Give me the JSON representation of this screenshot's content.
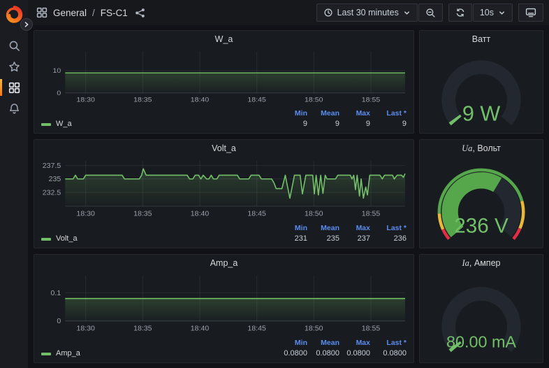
{
  "topbar": {
    "folder": "General",
    "separator": "/",
    "dashboard": "FS-C1",
    "time_range_label": "Last 30 minutes",
    "refresh_interval": "10s"
  },
  "legend_columns": [
    "Min",
    "Mean",
    "Max",
    "Last *"
  ],
  "charts": [
    {
      "type": "area",
      "title": "W_a",
      "series_name": "W_a",
      "unit": "W",
      "x_min": 28.2,
      "x_max": 58.0,
      "y_min": 0,
      "y_max": 18.7,
      "x_ticks": [
        {
          "value": 30,
          "label": "18:30"
        },
        {
          "value": 35,
          "label": "18:35"
        },
        {
          "value": 40,
          "label": "18:40"
        },
        {
          "value": 45,
          "label": "18:45"
        },
        {
          "value": 50,
          "label": "18:50"
        },
        {
          "value": 55,
          "label": "18:55"
        }
      ],
      "y_ticks": [
        {
          "value": 0,
          "label": "0"
        },
        {
          "value": 10,
          "label": "10"
        }
      ],
      "points": [
        [
          28.2,
          9
        ],
        [
          58.0,
          9
        ]
      ],
      "stats": {
        "min": "9",
        "mean": "9",
        "max": "9",
        "last": "9"
      }
    },
    {
      "type": "area",
      "title": "Volt_a",
      "series_name": "Volt_a",
      "unit": "V",
      "x_min": 28.2,
      "x_max": 58.0,
      "y_min": 229.9,
      "y_max": 238.4,
      "x_ticks": [
        {
          "value": 30,
          "label": "18:30"
        },
        {
          "value": 35,
          "label": "18:35"
        },
        {
          "value": 40,
          "label": "18:40"
        },
        {
          "value": 45,
          "label": "18:45"
        },
        {
          "value": 50,
          "label": "18:50"
        },
        {
          "value": 55,
          "label": "18:55"
        }
      ],
      "y_ticks": [
        {
          "value": 232.5,
          "label": "232.5"
        },
        {
          "value": 235,
          "label": "235"
        },
        {
          "value": 237.5,
          "label": "237.5"
        }
      ],
      "points": [
        [
          28.2,
          235
        ],
        [
          28.9,
          235
        ],
        [
          29.1,
          235.7
        ],
        [
          29.3,
          235
        ],
        [
          29.8,
          235
        ],
        [
          30.0,
          235.7
        ],
        [
          33.2,
          235.7
        ],
        [
          33.4,
          235
        ],
        [
          34.7,
          235
        ],
        [
          34.9,
          235.7
        ],
        [
          35.05,
          236.9
        ],
        [
          35.3,
          235.7
        ],
        [
          38.9,
          235.7
        ],
        [
          39.1,
          235
        ],
        [
          39.4,
          235
        ],
        [
          39.6,
          235.7
        ],
        [
          39.9,
          235.7
        ],
        [
          40.1,
          235
        ],
        [
          40.3,
          235.7
        ],
        [
          40.6,
          235
        ],
        [
          40.8,
          235
        ],
        [
          41.0,
          235.7
        ],
        [
          41.2,
          235
        ],
        [
          41.5,
          235
        ],
        [
          41.7,
          235.7
        ],
        [
          43.3,
          235.7
        ],
        [
          43.5,
          235
        ],
        [
          44.3,
          235
        ],
        [
          44.5,
          235.7
        ],
        [
          45.2,
          235.7
        ],
        [
          45.4,
          235
        ],
        [
          46.3,
          235
        ],
        [
          46.5,
          234.3
        ],
        [
          46.7,
          233.2
        ],
        [
          47.2,
          233.2
        ],
        [
          47.5,
          235.7
        ],
        [
          47.7,
          233.5
        ],
        [
          47.9,
          231.4
        ],
        [
          48.1,
          233.5
        ],
        [
          48.3,
          235.7
        ],
        [
          48.8,
          235.7
        ],
        [
          49.0,
          232.2
        ],
        [
          49.3,
          235.7
        ],
        [
          49.9,
          235.7
        ],
        [
          50.05,
          232.2
        ],
        [
          50.2,
          235.7
        ],
        [
          50.4,
          232.0
        ],
        [
          50.6,
          235.7
        ],
        [
          50.8,
          232.3
        ],
        [
          51.0,
          235.7
        ],
        [
          51.15,
          235
        ],
        [
          51.9,
          235
        ],
        [
          52.1,
          235.7
        ],
        [
          53.2,
          235.7
        ],
        [
          53.35,
          235
        ],
        [
          53.5,
          235.7
        ],
        [
          53.65,
          233
        ],
        [
          53.8,
          235.7
        ],
        [
          54.0,
          231.8
        ],
        [
          54.15,
          235
        ],
        [
          54.35,
          231.4
        ],
        [
          54.55,
          233.5
        ],
        [
          54.7,
          232
        ],
        [
          54.9,
          235.7
        ],
        [
          55.8,
          235.7
        ],
        [
          56.0,
          235
        ],
        [
          56.2,
          235.7
        ],
        [
          56.9,
          235.7
        ],
        [
          57.05,
          235
        ],
        [
          57.3,
          235.7
        ],
        [
          57.7,
          235.7
        ],
        [
          57.85,
          235.3
        ],
        [
          58.0,
          236
        ]
      ],
      "stats": {
        "min": "231",
        "mean": "235",
        "max": "237",
        "last": "236"
      }
    },
    {
      "type": "area",
      "title": "Amp_a",
      "series_name": "Amp_a",
      "unit": "A",
      "x_min": 28.2,
      "x_max": 58.0,
      "y_min": 0,
      "y_max": 0.162,
      "x_ticks": [
        {
          "value": 30,
          "label": "18:30"
        },
        {
          "value": 35,
          "label": "18:35"
        },
        {
          "value": 40,
          "label": "18:40"
        },
        {
          "value": 45,
          "label": "18:45"
        },
        {
          "value": 50,
          "label": "18:50"
        },
        {
          "value": 55,
          "label": "18:55"
        }
      ],
      "y_ticks": [
        {
          "value": 0,
          "label": "0"
        },
        {
          "value": 0.1,
          "label": "0.1"
        }
      ],
      "points": [
        [
          28.2,
          0.08
        ],
        [
          58.0,
          0.08
        ]
      ],
      "stats": {
        "min": "0.0800",
        "mean": "0.0800",
        "max": "0.0800",
        "last": "0.0800"
      }
    }
  ],
  "gauges": [
    {
      "title_italic": "",
      "title_text": "Ватт",
      "value": "9 W",
      "fraction": 0.02,
      "fill_color": "#73BF69",
      "thresholds": null
    },
    {
      "title_italic": "Ua",
      "title_text": ", Вольт",
      "value": "236 V",
      "fraction": 0.62,
      "fill_color": "#56A64B",
      "thresholds": [
        {
          "color": "#E02F44",
          "to": 0.06
        },
        {
          "color": "#EAB839",
          "to": 0.145
        },
        {
          "color": "#56A64B",
          "to": 0.79
        },
        {
          "color": "#EAB839",
          "to": 0.935
        },
        {
          "color": "#E02F44",
          "to": 1
        }
      ]
    },
    {
      "title_italic": "Ia",
      "title_text": ", Ампер",
      "value": "80.00 mA",
      "fraction": 0.02,
      "fill_color": "#73BF69",
      "thresholds": null
    }
  ],
  "colors": {
    "series_green": "#73BF69",
    "legend_header_blue": "#5B8DEF",
    "threshold_red": "#E02F44",
    "threshold_yellow": "#EAB839",
    "threshold_green": "#56A64B",
    "panel_bg": "#181B1F",
    "page_bg": "#111217"
  }
}
